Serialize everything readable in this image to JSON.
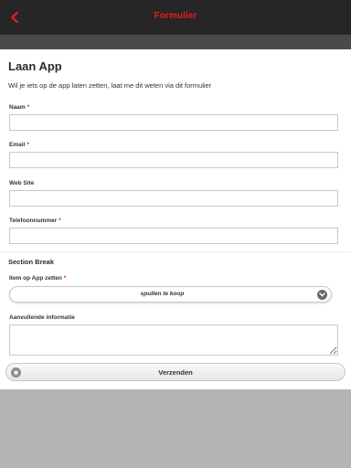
{
  "header": {
    "title": "Formulier",
    "back_icon": "chevron-left-icon",
    "accent_color": "#e41e1e"
  },
  "form": {
    "title": "Laan App",
    "description": "Wil je iets op de app laten zetten, laat me dit weten via dit formulier",
    "required_marker": "*",
    "fields": {
      "naam": {
        "label": "Naam",
        "required": true,
        "value": ""
      },
      "email": {
        "label": "Email",
        "required": true,
        "value": ""
      },
      "website": {
        "label": "Web Site",
        "required": false,
        "value": ""
      },
      "telefoon": {
        "label": "Telefoonnummer",
        "required": true,
        "value": ""
      }
    },
    "section_break": "Section Break",
    "item_select": {
      "label": "Item op App zetten",
      "required": true,
      "value": "spullen te koop",
      "icon": "chevron-down-icon"
    },
    "extra_info": {
      "label": "Aanvullende informatie",
      "value": ""
    },
    "submit": {
      "label": "Verzenden",
      "icon": "star-icon"
    }
  }
}
